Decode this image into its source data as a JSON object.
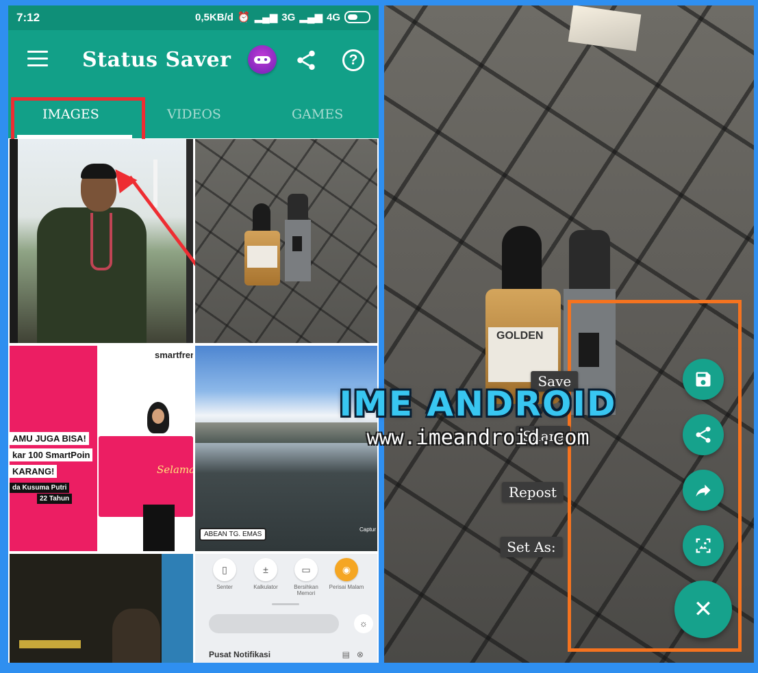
{
  "status_bar": {
    "time": "7:12",
    "network_speed": "0,5KB/d",
    "network_3g": "3G",
    "network_4g": "4G"
  },
  "app_bar": {
    "title": "Status Saver",
    "icons": [
      "menu-icon",
      "game-controller-icon",
      "share-icon",
      "help-icon"
    ]
  },
  "tabs": [
    {
      "label": "IMAGES",
      "active": true
    },
    {
      "label": "VIDEOS",
      "active": false
    },
    {
      "label": "GAMES",
      "active": false
    }
  ],
  "thumbnails": {
    "promo": {
      "brand": "smartfren",
      "line1": "AMU JUGA BISA!",
      "line2": "kar 100 SmartPoin",
      "line3": "KARANG!",
      "line4": "da Kusuma Putri",
      "line5": "22 Tahun",
      "card": "Selama"
    },
    "lake": {
      "caption": "ABEAN TG. EMAS",
      "credit": "Captur"
    },
    "quick_settings": {
      "buttons": [
        {
          "label": "Senter",
          "icon": "flashlight-icon"
        },
        {
          "label": "Kalkulator",
          "icon": "calculator-icon"
        },
        {
          "label": "Bersihkan Memori",
          "icon": "trash-icon"
        },
        {
          "label": "Perisai Malam",
          "icon": "eye-shield-icon"
        }
      ],
      "notification_title": "Pusat Notifikasi"
    }
  },
  "viewer": {
    "bottle_label": "GOLDEN",
    "actions": [
      {
        "label": "Save",
        "icon": "save-icon"
      },
      {
        "label": "Share",
        "icon": "share-icon"
      },
      {
        "label": "Repost",
        "icon": "repost-icon"
      },
      {
        "label": "Set As:",
        "icon": "set-as-icon"
      }
    ],
    "close_symbol": "✕"
  },
  "watermark": {
    "title": "IME ANDROID",
    "url": "www.imeandroid.com"
  },
  "colors": {
    "primary": "#12a088",
    "primary_dark": "#0f8f78",
    "fab": "#16a28c",
    "highlight_red": "#ee2d32",
    "highlight_orange": "#f5731f",
    "frame_blue": "#2f8ff0"
  }
}
